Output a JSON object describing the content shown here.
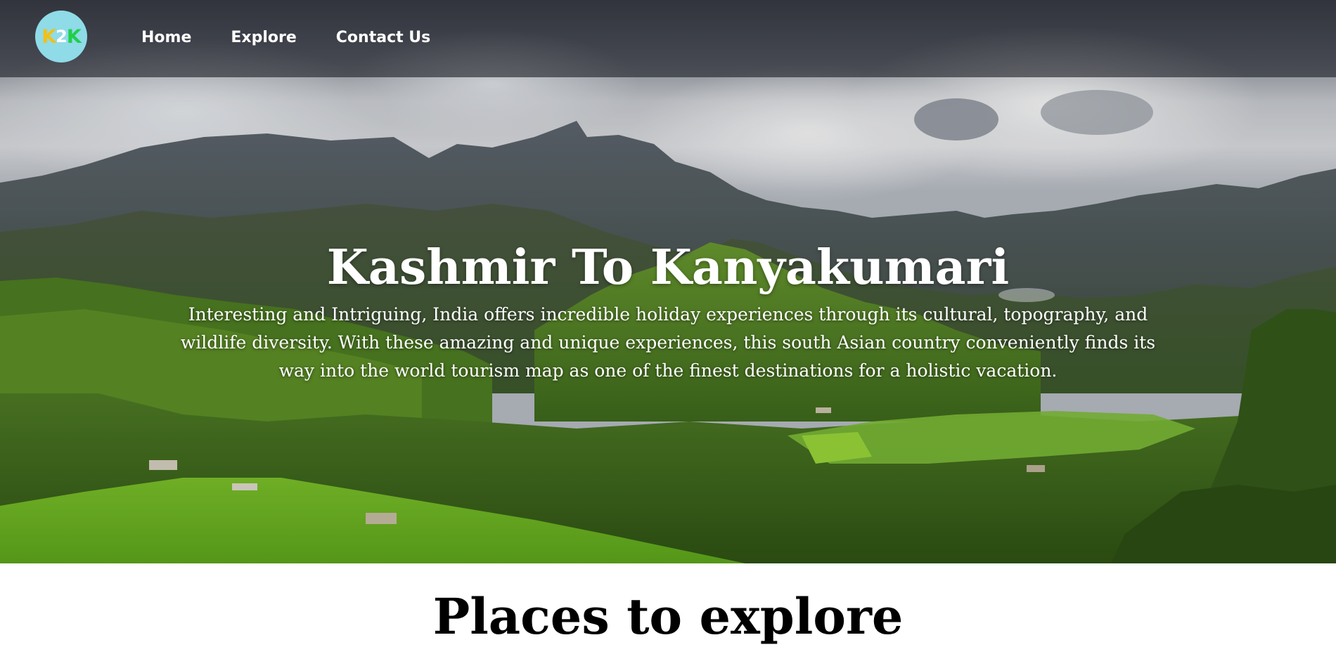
{
  "logo": {
    "part1": "K",
    "part2": "2",
    "part3": "K"
  },
  "nav": {
    "items": [
      {
        "label": "Home"
      },
      {
        "label": "Explore"
      },
      {
        "label": "Contact Us"
      }
    ]
  },
  "hero": {
    "title": "Kashmir To Kanyakumari",
    "description": "Interesting and Intriguing, India offers incredible holiday experiences through its cultural, topography, and wildlife diversity. With these amazing and unique experiences, this south Asian country conveniently finds its way into the world tourism map as one of the finest destinations for a holistic vacation."
  },
  "sections": {
    "places_title": "Places to explore"
  },
  "colors": {
    "navbar_bg": "#1e2028",
    "logo_bg": "#8fdbe8",
    "logo_k1": "#f2c018",
    "logo_k2": "#1fcf4a",
    "hero_text": "#ffffff",
    "section_title": "#000000"
  }
}
